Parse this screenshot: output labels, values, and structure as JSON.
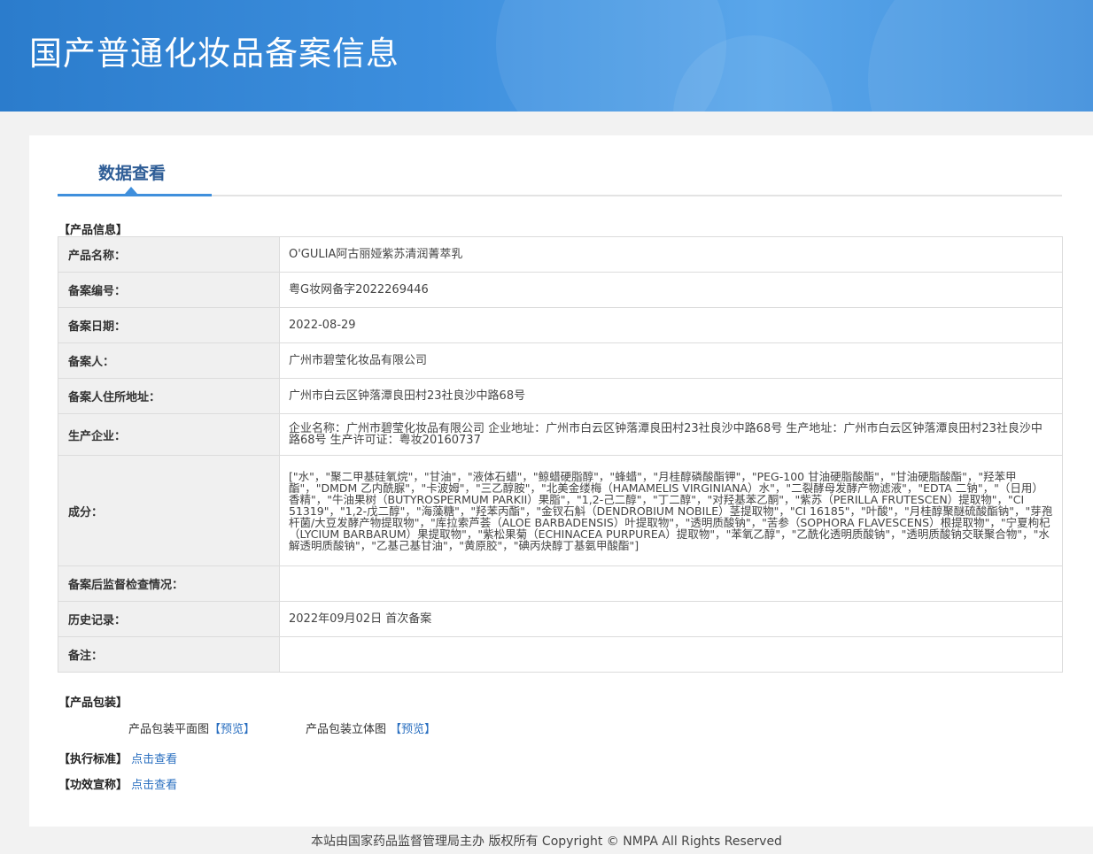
{
  "header": {
    "title": "国产普通化妆品备案信息"
  },
  "tabs": {
    "active_label": "数据查看"
  },
  "sections": {
    "product_info": "【产品信息】",
    "product_package": "【产品包装】",
    "exec_standard": "【执行标准】",
    "efficacy_claim": "【功效宣称】"
  },
  "product": {
    "rows": [
      {
        "label": "产品名称：",
        "value": "O'GULIA阿古丽娅紫苏清润菁萃乳"
      },
      {
        "label": "备案编号：",
        "value": "粤G妆网备字2022269446"
      },
      {
        "label": "备案日期：",
        "value": "2022-08-29"
      },
      {
        "label": "备案人：",
        "value": "广州市碧莹化妆品有限公司"
      },
      {
        "label": "备案人住所地址：",
        "value": "广州市白云区钟落潭良田村23社良沙中路68号"
      },
      {
        "label": "生产企业：",
        "value": "企业名称：广州市碧莹化妆品有限公司 企业地址：广州市白云区钟落潭良田村23社良沙中路68号 生产地址：广州市白云区钟落潭良田村23社良沙中路68号 生产许可证：粤妆20160737"
      },
      {
        "label": "成分：",
        "value": "[\"水\"，\"聚二甲基硅氧烷\"，\"甘油\"，\"液体石蜡\"，\"鲸蜡硬脂醇\"，\"蜂蜡\"，\"月桂醇磷酸酯钾\"，\"PEG-100 甘油硬脂酸酯\"，\"甘油硬脂酸酯\"，\"羟苯甲酯\"，\"DMDM 乙内酰脲\"，\"卡波姆\"，\"三乙醇胺\"，\"北美金缕梅（HAMAMELIS VIRGINIANA）水\"，\"二裂酵母发酵产物滤液\"，\"EDTA 二钠\"，\"（日用）香精\"，\"牛油果树（BUTYROSPERMUM PARKII）果脂\"，\"1,2-己二醇\"，\"丁二醇\"，\"对羟基苯乙酮\"，\"紫苏（PERILLA FRUTESCEN）提取物\"，\"CI 51319\"，\"1,2-戊二醇\"，\"海藻糖\"，\"羟苯丙酯\"，\"金钗石斛（DENDROBIUM NOBILE）茎提取物\"，\"CI 16185\"，\"叶酸\"，\"月桂醇聚醚硫酸酯钠\"，\"芽孢杆菌/大豆发酵产物提取物\"，\"库拉索芦荟（ALOE BARBADENSIS）叶提取物\"，\"透明质酸钠\"，\"苦参（SOPHORA FLAVESCENS）根提取物\"，\"宁夏枸杞（LYCIUM BARBARUM）果提取物\"，\"紫松果菊（ECHINACEA PURPUREA）提取物\"，\"苯氧乙醇\"，\"乙酰化透明质酸钠\"，\"透明质酸钠交联聚合物\"，\"水解透明质酸钠\"，\"乙基己基甘油\"，\"黄原胶\"，\"碘丙炔醇丁基氨甲酸酯\"]"
      },
      {
        "label": "备案后监督检查情况：",
        "value": ""
      },
      {
        "label": "历史记录：",
        "value": "2022年09月02日 首次备案"
      },
      {
        "label": "备注：",
        "value": ""
      }
    ]
  },
  "package": {
    "flat_label": "产品包装平面图",
    "flat_link": "【预览】",
    "solid_label": "产品包装立体图",
    "solid_link": "【预览】"
  },
  "links": {
    "exec_view": "点击查看",
    "efficacy_view": "点击查看"
  },
  "footer": {
    "text": "本站由国家药品监督管理局主办 版权所有 Copyright © NMPA All Rights Reserved"
  }
}
